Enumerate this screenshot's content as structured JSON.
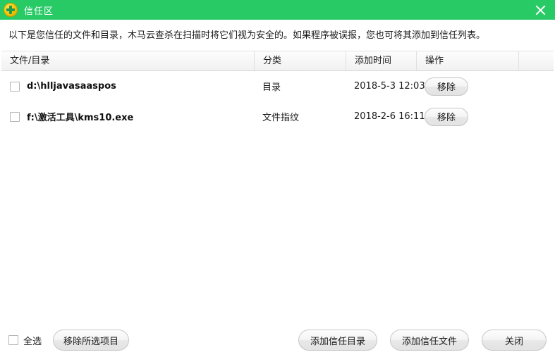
{
  "window": {
    "title": "信任区",
    "icon": "shield-plus-icon",
    "close_icon": "close-icon",
    "titlebar_color": "#27ca65"
  },
  "description": "以下是您信任的文件和目录，木马云查杀在扫描时将它们视为安全的。如果程序被误报，您也可将其添加到信任列表。",
  "table": {
    "columns": [
      {
        "key": "name",
        "label": "文件/目录"
      },
      {
        "key": "category",
        "label": "分类"
      },
      {
        "key": "time",
        "label": "添加时间"
      },
      {
        "key": "action",
        "label": "操作"
      }
    ],
    "rows": [
      {
        "checked": false,
        "name": "d:\\hlljavasaaspos",
        "category": "目录",
        "time": "2018-5-3 12:03",
        "action_label": "移除"
      },
      {
        "checked": false,
        "name": "f:\\激活工具\\kms10.exe",
        "category": "文件指纹",
        "time": "2018-2-6 16:11",
        "action_label": "移除"
      }
    ]
  },
  "footer": {
    "select_all_label": "全选",
    "select_all_checked": false,
    "remove_selected_label": "移除所选项目",
    "add_trusted_dir_label": "添加信任目录",
    "add_trusted_file_label": "添加信任文件",
    "close_label": "关闭"
  }
}
